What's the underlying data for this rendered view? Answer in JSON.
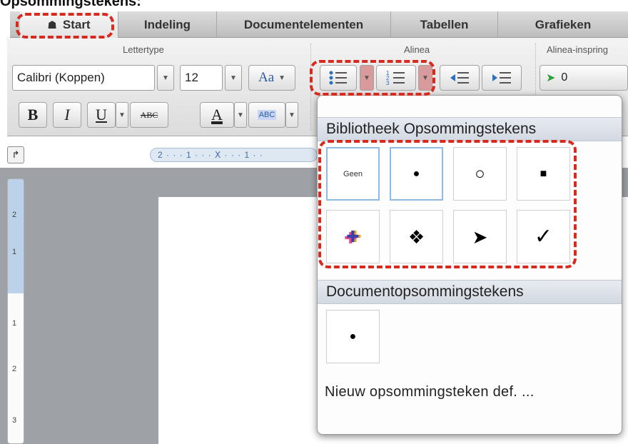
{
  "page_heading": "Opsommingstekens:",
  "tabs": [
    {
      "label": "Start",
      "icon": "home-icon"
    },
    {
      "label": "Indeling"
    },
    {
      "label": "Documentelementen"
    },
    {
      "label": "Tabellen"
    },
    {
      "label": "Grafieken"
    }
  ],
  "ribbon": {
    "font_group": {
      "title": "Lettertype",
      "font_name": "Calibri (Koppen)",
      "font_size": "12",
      "case_label": "Aa",
      "bold": "B",
      "italic": "I",
      "underline": "U",
      "strike": "ABC",
      "color_letter": "A",
      "highlight": "ABC"
    },
    "paragraph_group": {
      "title": "Alinea"
    },
    "indent_group": {
      "title": "Alinea-inspring",
      "value": "0"
    }
  },
  "ruler": {
    "text": "2 · · · 1 · · · Ⅹ · · · 1 · ·",
    "v_ticks": [
      "2",
      "1",
      "1",
      "2",
      "3"
    ]
  },
  "bullet_menu": {
    "library_title": "Bibliotheek Opsommingstekens",
    "library": [
      {
        "label": "Geen",
        "icon": "none-icon"
      },
      {
        "glyph": "●",
        "icon": "filled-circle-bullet-icon"
      },
      {
        "glyph": "○",
        "icon": "hollow-circle-bullet-icon"
      },
      {
        "glyph": "■",
        "icon": "square-bullet-icon"
      },
      {
        "glyph": "✚",
        "icon": "colored-cross-bullet-icon"
      },
      {
        "glyph": "❖",
        "icon": "diamond-cluster-bullet-icon"
      },
      {
        "glyph": "➤",
        "icon": "arrowhead-bullet-icon"
      },
      {
        "glyph": "✓",
        "icon": "checkmark-bullet-icon"
      }
    ],
    "document_title": "Documentopsommingstekens",
    "document_bullets": [
      {
        "glyph": "●",
        "icon": "filled-circle-bullet-icon"
      }
    ],
    "define_new": "Nieuw opsommingsteken def. ..."
  },
  "colors": {
    "highlight_red": "#d62a1f",
    "selection_blue": "#8ebbe6"
  }
}
